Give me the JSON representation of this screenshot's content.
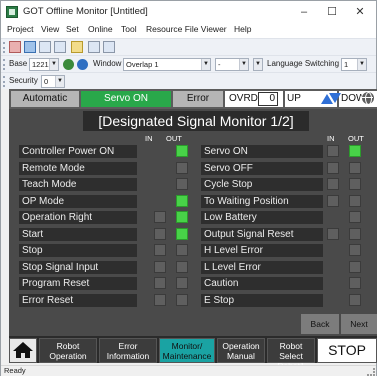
{
  "window": {
    "title": "GOT Offline Monitor [Untitled]",
    "minimize": "–",
    "maximize": "☐",
    "close": "✕"
  },
  "menu": {
    "items": [
      "Project",
      "View",
      "Set",
      "Online",
      "Tool",
      "Resource File Viewer",
      "Help"
    ]
  },
  "toolbar": {
    "base_label": "Base",
    "base_value": "1221",
    "window_label": "Window",
    "window_value": "Overlap 1",
    "dash_value": "-",
    "language_label": "Language Switching",
    "language_value": "1",
    "security_label": "Security",
    "security_value": "0"
  },
  "status": {
    "automatic": "Automatic",
    "servo_on": "Servo ON",
    "error": "Error",
    "ovrd": "OVRD",
    "ovrd_value": "0",
    "up": "UP",
    "down": "DOWN",
    "active_color": "#29a84a",
    "arrow_color": "#2f6fd6"
  },
  "screen_title": "[Designated Signal Monitor 1/2]",
  "columns": {
    "in": "IN",
    "out": "OUT"
  },
  "left_signals": [
    {
      "label": "Controller Power ON",
      "in": false,
      "out": true,
      "has_in": false
    },
    {
      "label": "Remote Mode",
      "in": false,
      "out": false,
      "has_in": false
    },
    {
      "label": "Teach Mode",
      "in": false,
      "out": false,
      "has_in": false
    },
    {
      "label": "OP Mode",
      "in": false,
      "out": true,
      "has_in": false
    },
    {
      "label": "Operation Right",
      "in": false,
      "out": true,
      "has_in": true
    },
    {
      "label": "Start",
      "in": false,
      "out": true,
      "has_in": true
    },
    {
      "label": "Stop",
      "in": false,
      "out": false,
      "has_in": true
    },
    {
      "label": "Stop Signal Input",
      "in": false,
      "out": false,
      "has_in": true
    },
    {
      "label": "Program Reset",
      "in": false,
      "out": false,
      "has_in": true
    },
    {
      "label": "Error Reset",
      "in": false,
      "out": false,
      "has_in": true
    }
  ],
  "right_signals": [
    {
      "label": "Servo ON",
      "in": false,
      "out": true,
      "has_in": true
    },
    {
      "label": "Servo OFF",
      "in": false,
      "out": false,
      "has_in": true
    },
    {
      "label": "Cycle Stop",
      "in": false,
      "out": false,
      "has_in": true
    },
    {
      "label": "To Waiting Position",
      "in": false,
      "out": false,
      "has_in": true
    },
    {
      "label": "Low Battery",
      "in": false,
      "out": false,
      "has_in": false
    },
    {
      "label": "Output Signal Reset",
      "in": false,
      "out": false,
      "has_in": true
    },
    {
      "label": "H Level Error",
      "in": false,
      "out": false,
      "has_in": false
    },
    {
      "label": "L Level Error",
      "in": false,
      "out": false,
      "has_in": false
    },
    {
      "label": "Caution",
      "in": false,
      "out": false,
      "has_in": false
    },
    {
      "label": "E Stop",
      "in": false,
      "out": false,
      "has_in": false
    }
  ],
  "nav": {
    "back": "Back",
    "next": "Next"
  },
  "bottom": {
    "robot_operation": "Robot Operation",
    "error_information": "Error Information",
    "monitor_maintenance": "Monitor/ Maintenance",
    "operation_manual": "Operation Manual",
    "robot_select": "Robot Select Robot1",
    "stop": "STOP"
  },
  "statusbar": {
    "text": "Ready"
  }
}
